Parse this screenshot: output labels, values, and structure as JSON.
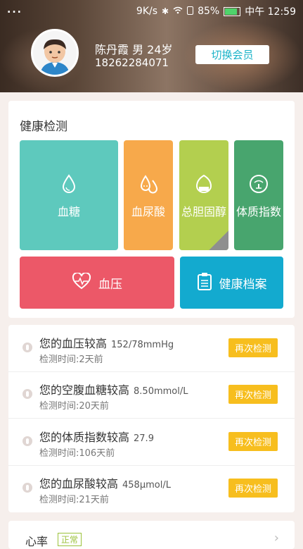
{
  "status_bar": {
    "left": "...",
    "speed": "9K/s",
    "battery": "85%",
    "time": "中午 12:59"
  },
  "profile": {
    "name_line": "陈丹霞  男 24岁",
    "phone": "18262284071",
    "switch_label": "切换会员"
  },
  "health": {
    "title": "健康检测",
    "tiles": [
      {
        "label": "血糖",
        "icon": "drop-icon",
        "color": "#5ec9bd"
      },
      {
        "label": "血尿酸",
        "icon": "drops-icon",
        "color": "#f7a94b"
      },
      {
        "label": "总胆固醇",
        "icon": "egg-icon",
        "color": "#b3cf4f"
      },
      {
        "label": "体质指数",
        "icon": "gauge-icon",
        "color": "#48a56e"
      },
      {
        "label": "血压",
        "icon": "heart-pulse-icon",
        "color": "#ec5868"
      },
      {
        "label": "健康档案",
        "icon": "clipboard-icon",
        "color": "#13aacf"
      }
    ]
  },
  "alerts": [
    {
      "title": "您的血压较高",
      "value": "152/78mmHg",
      "time": "检测时间:2天前",
      "button": "再次检测"
    },
    {
      "title": "您的空腹血糖较高",
      "value": "8.50mmol/L",
      "time": "检测时间:20天前",
      "button": "再次检测"
    },
    {
      "title": "您的体质指数较高",
      "value": "27.9",
      "time": "检测时间:106天前",
      "button": "再次检测"
    },
    {
      "title": "您的血尿酸较高",
      "value": "458μmol/L",
      "time": "检测时间:21天前",
      "button": "再次检测"
    }
  ],
  "bottom": {
    "label": "心率",
    "tag": "正常"
  }
}
